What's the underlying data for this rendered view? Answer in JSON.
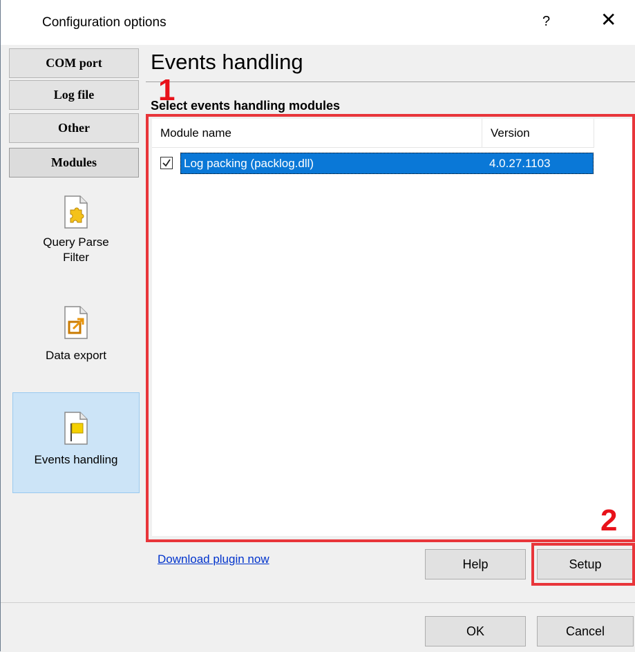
{
  "window": {
    "title": "Configuration options",
    "help_label": "?",
    "close_label": "✕"
  },
  "nav": {
    "items": [
      {
        "label": "COM port"
      },
      {
        "label": "Log file"
      },
      {
        "label": "Other"
      },
      {
        "label": "Modules"
      }
    ]
  },
  "modules": {
    "items": [
      {
        "label_line1": "Query Parse",
        "label_line2": "Filter",
        "icon": "puzzle-icon"
      },
      {
        "label_line1": "Data export",
        "icon": "export-icon"
      },
      {
        "label_line1": "Events handling",
        "icon": "flag-icon"
      }
    ]
  },
  "main": {
    "title": "Events handling",
    "section_label": "Select events handling modules",
    "columns": [
      "Module name",
      "Version"
    ],
    "rows": [
      {
        "checked": true,
        "name": "Log packing (packlog.dll)",
        "version": "4.0.27.1103"
      }
    ],
    "download_link": "Download plugin now",
    "help_button": "Help",
    "setup_button": "Setup"
  },
  "annotations": {
    "marker_1": "1",
    "marker_2": "2",
    "color": "#e8353a"
  },
  "footer": {
    "ok_button": "OK",
    "cancel_button": "Cancel"
  }
}
